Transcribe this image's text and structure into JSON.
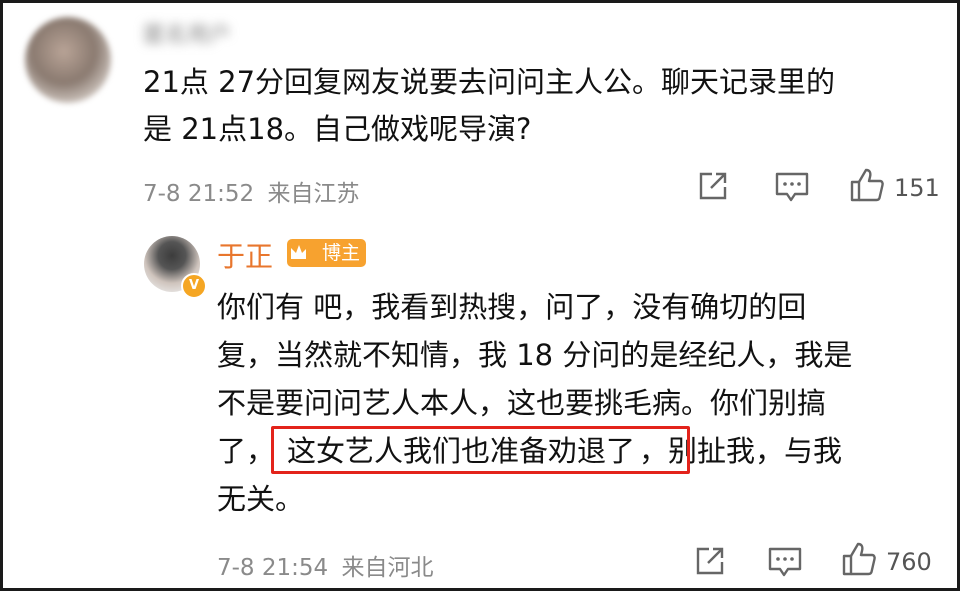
{
  "comment": {
    "username_blurred": "匿名用户",
    "text_line1": "21点 27分回复网友说要去问问主人公。聊天记录里的",
    "text_line2": "是 21点18。自己做戏呢导演?",
    "time": "7-8 21:52",
    "location": "来自江苏",
    "likes": "151",
    "icons": [
      "share-icon",
      "comment-icon",
      "like-icon"
    ]
  },
  "reply": {
    "author": "于正",
    "badge": "博主",
    "verified_mark": "V",
    "line1": "你们有   吧，我看到热搜，问了，没有确切的回",
    "line2": "复，当然就不知情，我 18 分问的是经纪人，我是",
    "line3": "不是要问问艺人本人，这也要挑毛病。你们别搞",
    "line4_prefix": "了，",
    "line4_highlight": "这女艺人我们也准备劝退了",
    "line4_suffix": "，别扯我，与我",
    "line5": "无关。",
    "time": "7-8 21:54",
    "location": "来自河北",
    "likes": "760",
    "icons": [
      "share-icon",
      "comment-icon",
      "like-icon"
    ]
  },
  "colors": {
    "author_name": "#e8762d",
    "badge_bg": "#f7a22f",
    "highlight_border": "#e3231b",
    "meta_text": "#8a8a8a"
  }
}
